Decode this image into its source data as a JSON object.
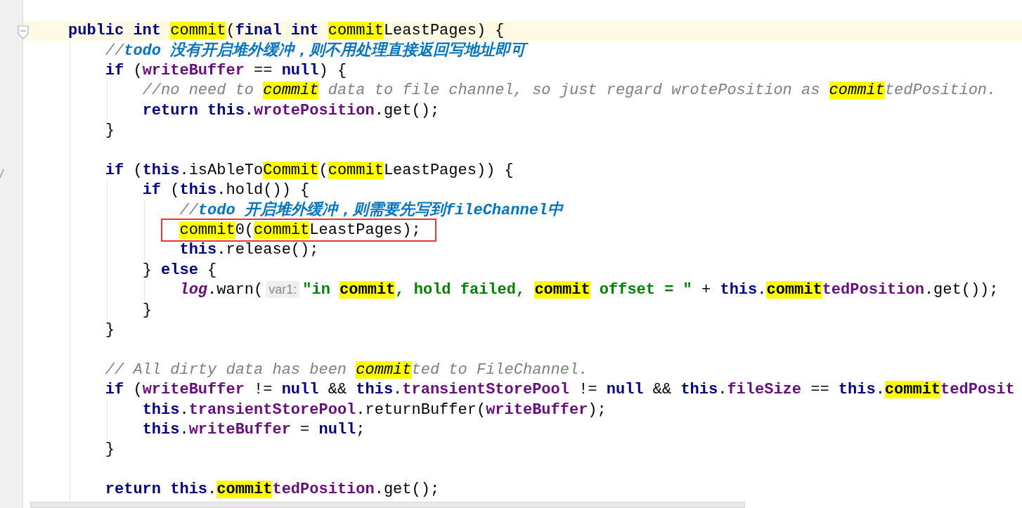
{
  "editor": {
    "lines": [
      {
        "current": true,
        "tokens": [
          {
            "text": "public int ",
            "kind": "keyword"
          },
          {
            "kind": "caret"
          },
          {
            "text": "commit",
            "kind": "match"
          },
          {
            "text": "(",
            "kind": "plain"
          },
          {
            "text": "final int ",
            "kind": "keyword"
          },
          {
            "text": "commit",
            "kind": "match"
          },
          {
            "text": "LeastPages) {",
            "kind": "plain"
          }
        ]
      },
      {
        "current": false,
        "tokens": [
          {
            "text": "    //",
            "kind": "comment"
          },
          {
            "text": "todo 没有开启堆外缓冲，则不用处理直接返回写地址即可",
            "kind": "todo"
          }
        ]
      },
      {
        "current": false,
        "tokens": [
          {
            "text": "    if ",
            "kind": "keyword"
          },
          {
            "text": "(",
            "kind": "plain"
          },
          {
            "text": "writeBuffer",
            "kind": "field"
          },
          {
            "text": " == ",
            "kind": "plain"
          },
          {
            "text": "null",
            "kind": "keyword"
          },
          {
            "text": ") {",
            "kind": "plain"
          }
        ]
      },
      {
        "current": false,
        "tokens": [
          {
            "text": "        //no need to ",
            "kind": "comment"
          },
          {
            "text": "commit",
            "kind": "matchitalic"
          },
          {
            "text": " data to file channel, so just regard wrotePosition as ",
            "kind": "comment"
          },
          {
            "text": "commit",
            "kind": "matchitalic"
          },
          {
            "text": "tedPosition.",
            "kind": "comment"
          }
        ]
      },
      {
        "current": false,
        "tokens": [
          {
            "text": "        return this",
            "kind": "keyword"
          },
          {
            "text": ".",
            "kind": "plain"
          },
          {
            "text": "wrotePosition",
            "kind": "field"
          },
          {
            "text": ".get();",
            "kind": "plain"
          }
        ]
      },
      {
        "current": false,
        "tokens": [
          {
            "text": "    }",
            "kind": "plain"
          }
        ]
      },
      {
        "current": false
      },
      {
        "current": false,
        "tokens": [
          {
            "text": "    if ",
            "kind": "keyword"
          },
          {
            "text": "(",
            "kind": "plain"
          },
          {
            "text": "this",
            "kind": "keyword"
          },
          {
            "text": ".isAbleTo",
            "kind": "plain"
          },
          {
            "text": "Commit",
            "kind": "match"
          },
          {
            "text": "(",
            "kind": "plain"
          },
          {
            "text": "commit",
            "kind": "match"
          },
          {
            "text": "LeastPages)) {",
            "kind": "plain"
          }
        ]
      },
      {
        "current": false,
        "tokens": [
          {
            "text": "        if ",
            "kind": "keyword"
          },
          {
            "text": "(",
            "kind": "plain"
          },
          {
            "text": "this",
            "kind": "keyword"
          },
          {
            "text": ".hold()) {",
            "kind": "plain"
          }
        ]
      },
      {
        "current": false,
        "tokens": [
          {
            "text": "            //",
            "kind": "comment"
          },
          {
            "text": "todo 开启堆外缓冲，则需要先写到fileChannel中",
            "kind": "todo"
          }
        ]
      },
      {
        "current": false,
        "boxed": true,
        "tokens": [
          {
            "text": "            commit",
            "kind": "match"
          },
          {
            "text": "0(",
            "kind": "plain"
          },
          {
            "text": "commit",
            "kind": "match"
          },
          {
            "text": "LeastPages);",
            "kind": "plain"
          }
        ]
      },
      {
        "current": false,
        "tokens": [
          {
            "text": "            this",
            "kind": "keyword"
          },
          {
            "text": ".release();",
            "kind": "plain"
          }
        ]
      },
      {
        "current": false,
        "tokens": [
          {
            "text": "        } ",
            "kind": "plain"
          },
          {
            "text": "else ",
            "kind": "keyword"
          },
          {
            "text": "{",
            "kind": "plain"
          }
        ]
      },
      {
        "current": false,
        "tokens": [
          {
            "text": "            log",
            "kind": "static"
          },
          {
            "text": ".warn(",
            "kind": "plain"
          },
          {
            "text": "var1:",
            "kind": "hint"
          },
          {
            "text": "\"in ",
            "kind": "string"
          },
          {
            "text": "commit",
            "kind": "matchbold"
          },
          {
            "text": ", hold failed, ",
            "kind": "string"
          },
          {
            "text": "commit",
            "kind": "matchbold"
          },
          {
            "text": " offset = \"",
            "kind": "string"
          },
          {
            "text": " + ",
            "kind": "plain"
          },
          {
            "text": "this",
            "kind": "keyword"
          },
          {
            "text": ".",
            "kind": "plain"
          },
          {
            "text": "commit",
            "kind": "matchbold"
          },
          {
            "text": "tedPosition",
            "kind": "field"
          },
          {
            "text": ".get());",
            "kind": "plain"
          }
        ]
      },
      {
        "current": false,
        "tokens": [
          {
            "text": "        }",
            "kind": "plain"
          }
        ]
      },
      {
        "current": false,
        "tokens": [
          {
            "text": "    }",
            "kind": "plain"
          }
        ]
      },
      {
        "current": false
      },
      {
        "current": false,
        "tokens": [
          {
            "text": "    // All dirty data has been ",
            "kind": "comment"
          },
          {
            "text": "commit",
            "kind": "matchitalic"
          },
          {
            "text": "ted to FileChannel.",
            "kind": "comment"
          }
        ]
      },
      {
        "current": false,
        "tokens": [
          {
            "text": "    if ",
            "kind": "keyword"
          },
          {
            "text": "(",
            "kind": "plain"
          },
          {
            "text": "writeBuffer",
            "kind": "field"
          },
          {
            "text": " != ",
            "kind": "plain"
          },
          {
            "text": "null ",
            "kind": "keyword"
          },
          {
            "text": "&& ",
            "kind": "plain"
          },
          {
            "text": "this",
            "kind": "keyword"
          },
          {
            "text": ".",
            "kind": "plain"
          },
          {
            "text": "transientStorePool",
            "kind": "field"
          },
          {
            "text": " != ",
            "kind": "plain"
          },
          {
            "text": "null ",
            "kind": "keyword"
          },
          {
            "text": "&& ",
            "kind": "plain"
          },
          {
            "text": "this",
            "kind": "keyword"
          },
          {
            "text": ".",
            "kind": "plain"
          },
          {
            "text": "fileSize",
            "kind": "field"
          },
          {
            "text": " == ",
            "kind": "plain"
          },
          {
            "text": "this",
            "kind": "keyword"
          },
          {
            "text": ".",
            "kind": "plain"
          },
          {
            "text": "commit",
            "kind": "matchbold"
          },
          {
            "text": "tedPosit",
            "kind": "field"
          }
        ]
      },
      {
        "current": false,
        "tokens": [
          {
            "text": "        this",
            "kind": "keyword"
          },
          {
            "text": ".",
            "kind": "plain"
          },
          {
            "text": "transientStorePool",
            "kind": "field"
          },
          {
            "text": ".returnBuffer(",
            "kind": "plain"
          },
          {
            "text": "writeBuffer",
            "kind": "field"
          },
          {
            "text": ");",
            "kind": "plain"
          }
        ]
      },
      {
        "current": false,
        "tokens": [
          {
            "text": "        this",
            "kind": "keyword"
          },
          {
            "text": ".",
            "kind": "plain"
          },
          {
            "text": "writeBuffer",
            "kind": "field"
          },
          {
            "text": " = ",
            "kind": "plain"
          },
          {
            "text": "null",
            "kind": "keyword"
          },
          {
            "text": ";",
            "kind": "plain"
          }
        ]
      },
      {
        "current": false,
        "tokens": [
          {
            "text": "    }",
            "kind": "plain"
          }
        ]
      },
      {
        "current": false
      },
      {
        "current": false,
        "tokens": [
          {
            "text": "    return this",
            "kind": "keyword"
          },
          {
            "text": ".",
            "kind": "plain"
          },
          {
            "text": "commit",
            "kind": "matchbold"
          },
          {
            "text": "tedPosition",
            "kind": "field"
          },
          {
            "text": ".get();",
            "kind": "plain"
          }
        ]
      }
    ]
  }
}
